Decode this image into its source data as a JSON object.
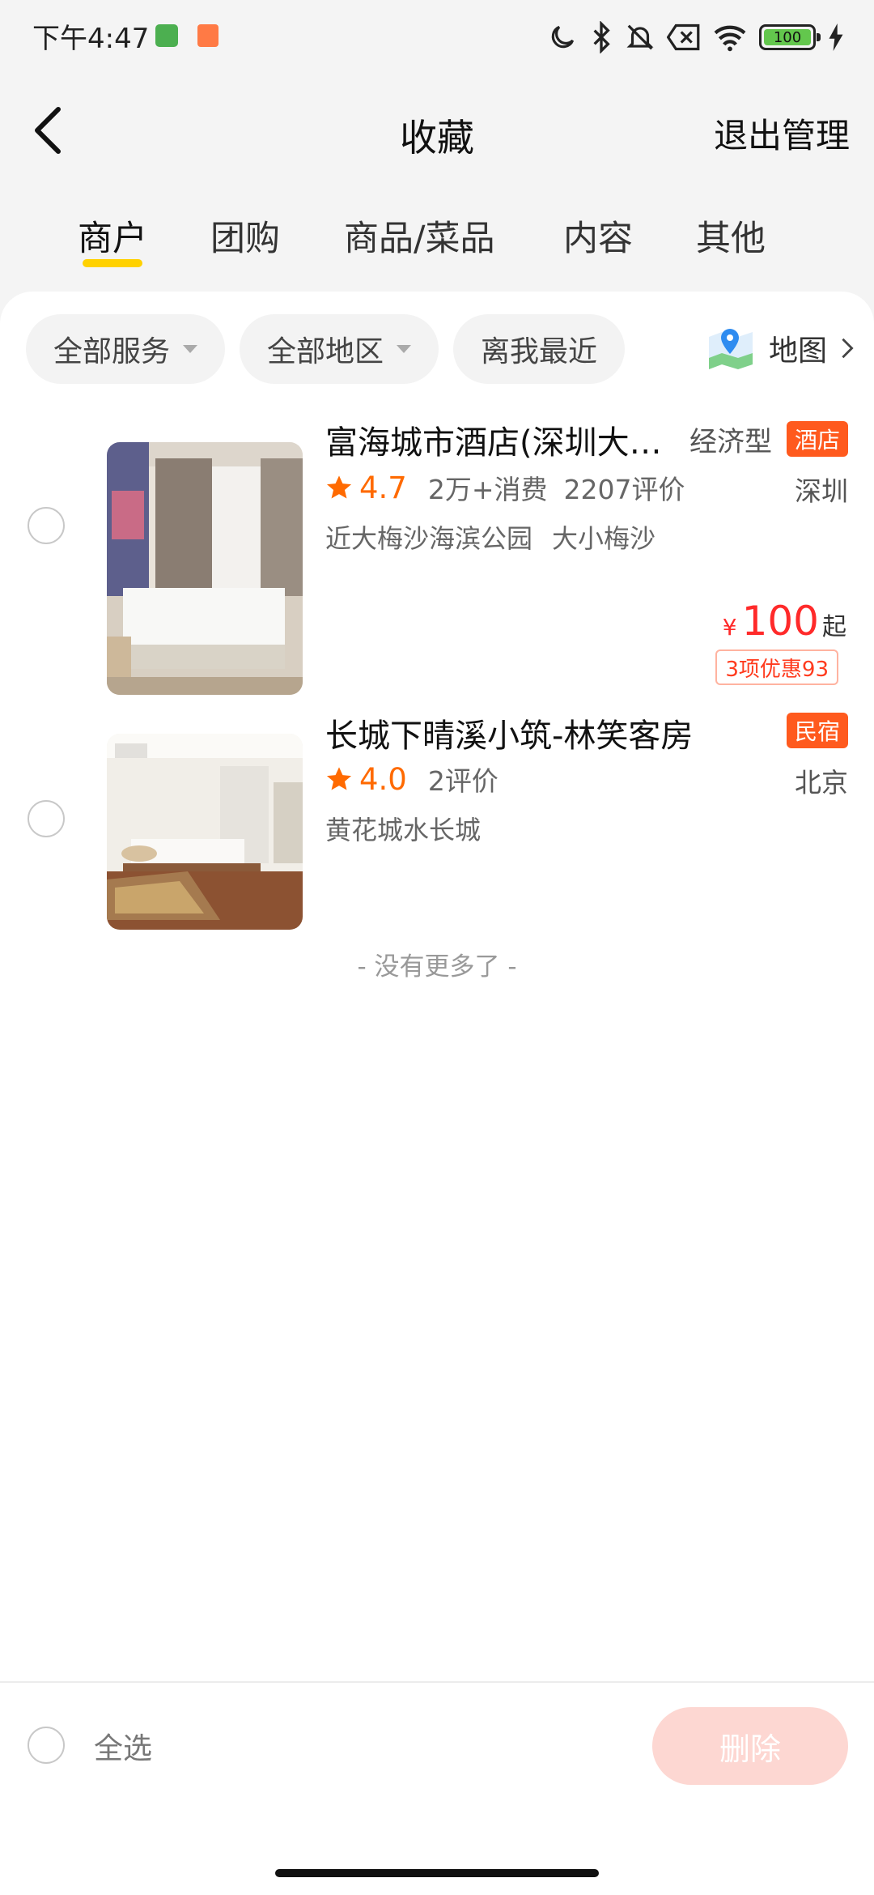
{
  "status_bar": {
    "time": "下午4:47",
    "battery": "100",
    "icons": [
      "green-app-icon",
      "shopping-bag-icon",
      "moon-icon",
      "bluetooth-icon",
      "bell-off-icon",
      "x-box-icon",
      "wifi-icon",
      "battery-icon",
      "charging-icon"
    ]
  },
  "nav": {
    "title": "收藏",
    "action": "退出管理",
    "back_icon": "chevron-left-icon"
  },
  "tabs": [
    {
      "label": "商户",
      "active": true
    },
    {
      "label": "团购",
      "active": false
    },
    {
      "label": "商品/菜品",
      "active": false
    },
    {
      "label": "内容",
      "active": false
    },
    {
      "label": "其他",
      "active": false
    }
  ],
  "filters": [
    {
      "label": "全部服务",
      "has_caret": true
    },
    {
      "label": "全部地区",
      "has_caret": true
    },
    {
      "label": "离我最近",
      "has_caret": false
    }
  ],
  "map": {
    "label": "地图",
    "icon": "map-pin-icon"
  },
  "items": [
    {
      "name": "富海城市酒店(深圳大…",
      "type": "经济型",
      "badge": "酒店",
      "rating": "4.7",
      "meta1": "2万+消费",
      "meta2": "2207评价",
      "city": "深圳",
      "tags": [
        "近大梅沙海滨公园",
        "大小梅沙"
      ],
      "price_currency": "¥",
      "price": "100",
      "price_suffix": "起",
      "promo": "3项优惠93"
    },
    {
      "name": "长城下晴溪小筑-林笑客房",
      "badge": "民宿",
      "rating": "4.0",
      "meta1": "2评价",
      "city": "北京",
      "tags": [
        "黄花城水长城"
      ]
    }
  ],
  "no_more": "- 没有更多了 -",
  "bottom": {
    "select_all": "全选",
    "delete": "删除"
  },
  "colors": {
    "accent_yellow": "#ffd100",
    "rating_orange": "#ff6a00",
    "badge_orange": "#ff5a1e",
    "price_red": "#ff2a2a",
    "delete_disabled": "#fdd7d2"
  }
}
